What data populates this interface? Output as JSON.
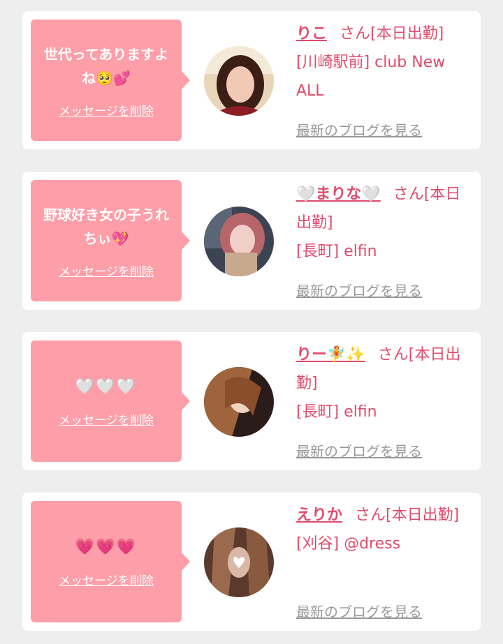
{
  "posts": [
    {
      "message": "世代ってありますよね",
      "message_emoji": "🥺💕",
      "delete_label": "メッセージを削除",
      "name": "りこ",
      "suffix": "さん[本日出勤]",
      "shop": "[川崎駅前] club New ALL",
      "blog_link": "最新のブログを見る"
    },
    {
      "message": "野球好き女の子うれちぃ",
      "message_emoji": "💖",
      "delete_label": "メッセージを削除",
      "name": "🤍まりな🤍",
      "suffix": "さん[本日出勤]",
      "shop": "[長町] elfin",
      "blog_link": "最新のブログを見る"
    },
    {
      "message": "🤍🤍🤍",
      "message_emoji": "",
      "delete_label": "メッセージを削除",
      "name": "りー🧚✨",
      "suffix": "さん[本日出勤]",
      "shop": "[長町] elfin",
      "blog_link": "最新のブログを見る"
    },
    {
      "message": "💗💗💗",
      "message_emoji": "",
      "delete_label": "メッセージを削除",
      "name": "えりか",
      "suffix": "さん[本日出勤]",
      "shop": "[刈谷] @dress",
      "blog_link": "最新のブログを見る"
    }
  ],
  "colors": {
    "page_bg": "#eeeeee",
    "bubble_bg": "#fd9ea8",
    "accent_text": "#e14b6c",
    "link_gray": "#999999"
  }
}
